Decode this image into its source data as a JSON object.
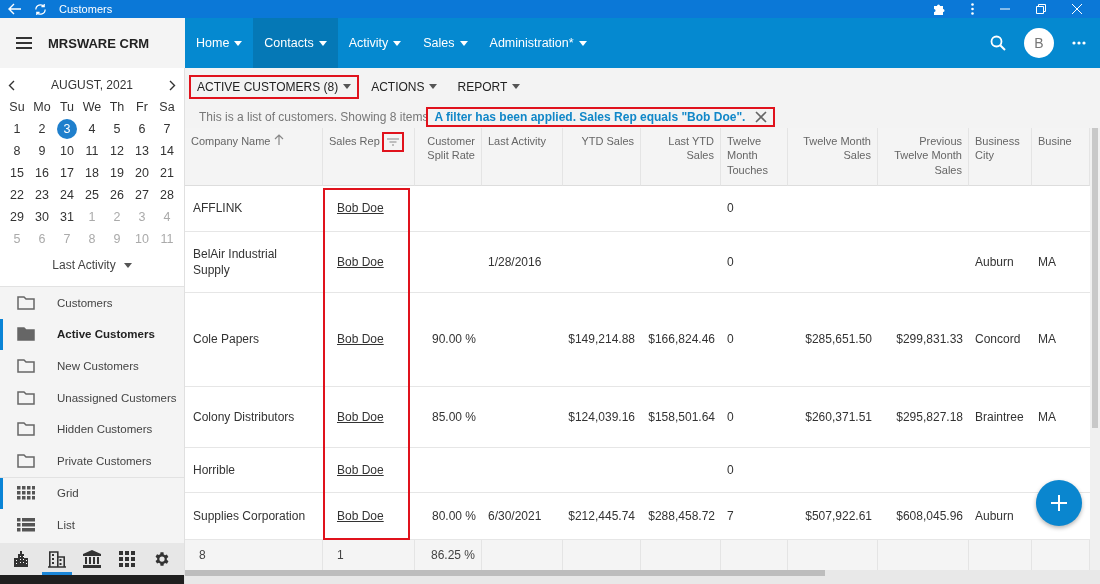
{
  "window": {
    "title": "Customers"
  },
  "app": {
    "name": "MRSWARE CRM",
    "avatar": "B"
  },
  "nav": [
    {
      "label": "Home",
      "selected": false
    },
    {
      "label": "Contacts",
      "selected": true
    },
    {
      "label": "Activity",
      "selected": false
    },
    {
      "label": "Sales",
      "selected": false
    },
    {
      "label": "Administration*",
      "selected": false
    }
  ],
  "calendar": {
    "month": "AUGUST, 2021",
    "weekdays": [
      "Su",
      "Mo",
      "Tu",
      "We",
      "Th",
      "Fr",
      "Sa"
    ],
    "weeks": [
      [
        {
          "day": "1",
          "current_month": true,
          "selected": false
        },
        {
          "day": "2",
          "current_month": true,
          "selected": false
        },
        {
          "day": "3",
          "current_month": true,
          "selected": true
        },
        {
          "day": "4",
          "current_month": true,
          "selected": false
        },
        {
          "day": "5",
          "current_month": true,
          "selected": false
        },
        {
          "day": "6",
          "current_month": true,
          "selected": false
        },
        {
          "day": "7",
          "current_month": true,
          "selected": false
        }
      ],
      [
        {
          "day": "8",
          "current_month": true,
          "selected": false
        },
        {
          "day": "9",
          "current_month": true,
          "selected": false
        },
        {
          "day": "10",
          "current_month": true,
          "selected": false
        },
        {
          "day": "11",
          "current_month": true,
          "selected": false
        },
        {
          "day": "12",
          "current_month": true,
          "selected": false
        },
        {
          "day": "13",
          "current_month": true,
          "selected": false
        },
        {
          "day": "14",
          "current_month": true,
          "selected": false
        }
      ],
      [
        {
          "day": "15",
          "current_month": true,
          "selected": false
        },
        {
          "day": "16",
          "current_month": true,
          "selected": false
        },
        {
          "day": "17",
          "current_month": true,
          "selected": false
        },
        {
          "day": "18",
          "current_month": true,
          "selected": false
        },
        {
          "day": "19",
          "current_month": true,
          "selected": false
        },
        {
          "day": "20",
          "current_month": true,
          "selected": false
        },
        {
          "day": "21",
          "current_month": true,
          "selected": false
        }
      ],
      [
        {
          "day": "22",
          "current_month": true,
          "selected": false
        },
        {
          "day": "23",
          "current_month": true,
          "selected": false
        },
        {
          "day": "24",
          "current_month": true,
          "selected": false
        },
        {
          "day": "25",
          "current_month": true,
          "selected": false
        },
        {
          "day": "26",
          "current_month": true,
          "selected": false
        },
        {
          "day": "27",
          "current_month": true,
          "selected": false
        },
        {
          "day": "28",
          "current_month": true,
          "selected": false
        }
      ],
      [
        {
          "day": "29",
          "current_month": true,
          "selected": false
        },
        {
          "day": "30",
          "current_month": true,
          "selected": false
        },
        {
          "day": "31",
          "current_month": true,
          "selected": false
        },
        {
          "day": "1",
          "current_month": false,
          "selected": false
        },
        {
          "day": "2",
          "current_month": false,
          "selected": false
        },
        {
          "day": "3",
          "current_month": false,
          "selected": false
        },
        {
          "day": "4",
          "current_month": false,
          "selected": false
        }
      ],
      [
        {
          "day": "5",
          "current_month": false,
          "selected": false
        },
        {
          "day": "6",
          "current_month": false,
          "selected": false
        },
        {
          "day": "7",
          "current_month": false,
          "selected": false
        },
        {
          "day": "8",
          "current_month": false,
          "selected": false
        },
        {
          "day": "9",
          "current_month": false,
          "selected": false
        },
        {
          "day": "10",
          "current_month": false,
          "selected": false
        },
        {
          "day": "11",
          "current_month": false,
          "selected": false
        }
      ]
    ],
    "date_field": "Last Activity"
  },
  "folders": [
    {
      "label": "Customers",
      "selected": false
    },
    {
      "label": "Active Customers",
      "selected": true
    },
    {
      "label": "New Customers",
      "selected": false
    },
    {
      "label": "Unassigned Customers",
      "selected": false
    },
    {
      "label": "Hidden Customers",
      "selected": false
    },
    {
      "label": "Private Customers",
      "selected": false
    }
  ],
  "views": [
    {
      "label": "Grid",
      "kind": "grid",
      "selected": true
    },
    {
      "label": "List",
      "kind": "list",
      "selected": false
    }
  ],
  "bottom_tabs": [
    {
      "kind": "city",
      "selected": false
    },
    {
      "kind": "building",
      "selected": true
    },
    {
      "kind": "bank",
      "selected": false
    },
    {
      "kind": "apps",
      "selected": false
    },
    {
      "kind": "settings",
      "selected": false
    }
  ],
  "toolbar": [
    {
      "label": "ACTIVE CUSTOMERS (8)",
      "annotated": true
    },
    {
      "label": "ACTIONS",
      "annotated": false
    },
    {
      "label": "REPORT",
      "annotated": false
    }
  ],
  "info": {
    "text": "This is a list of customers. Showing 8 items",
    "filter_notice": "A filter has been applied. Sales Rep equals \"Bob Doe\".",
    "annotated": true
  },
  "table": {
    "columns": [
      {
        "label": "Company Name",
        "kind": "text",
        "sorted": true,
        "filtered": false,
        "annotated": false
      },
      {
        "label": "Sales Rep",
        "kind": "link",
        "sorted": false,
        "filtered": true,
        "annotated": true
      },
      {
        "label": "Customer Split Rate",
        "kind": "text",
        "sorted": false,
        "filtered": false,
        "annotated": false
      },
      {
        "label": "Last Activity",
        "kind": "text",
        "sorted": false,
        "filtered": false,
        "annotated": false
      },
      {
        "label": "YTD Sales",
        "kind": "text",
        "sorted": false,
        "filtered": false,
        "annotated": false
      },
      {
        "label": "Last YTD Sales",
        "kind": "text",
        "sorted": false,
        "filtered": false,
        "annotated": false
      },
      {
        "label": "Twelve Month Touches",
        "kind": "text",
        "sorted": false,
        "filtered": false,
        "annotated": false
      },
      {
        "label": "Twelve Month Sales",
        "kind": "text",
        "sorted": false,
        "filtered": false,
        "annotated": false
      },
      {
        "label": "Previous Twelve Month Sales",
        "kind": "text",
        "sorted": false,
        "filtered": false,
        "annotated": false
      },
      {
        "label": "Business City",
        "kind": "text",
        "sorted": false,
        "filtered": false,
        "annotated": false
      },
      {
        "label": "Busine",
        "kind": "text",
        "sorted": false,
        "filtered": false,
        "annotated": false
      }
    ],
    "rows": [
      [
        "AFFLINK",
        "Bob Doe",
        null,
        null,
        null,
        null,
        "0",
        null,
        null,
        null,
        null
      ],
      [
        "BelAir Industrial Supply",
        "Bob Doe",
        null,
        "1/28/2016",
        null,
        null,
        "0",
        null,
        null,
        "Auburn",
        "MA"
      ],
      [
        "Cole Papers",
        "Bob Doe",
        "90.00 %",
        null,
        "$149,214.88",
        "$166,824.46",
        "0",
        "$285,651.50",
        "$299,831.33",
        "Concord",
        "MA"
      ],
      [
        "Colony Distributors",
        "Bob Doe",
        "85.00 %",
        null,
        "$124,039.16",
        "$158,501.64",
        "0",
        "$260,371.51",
        "$295,827.18",
        "Braintree",
        "MA"
      ],
      [
        "Horrible",
        "Bob Doe",
        null,
        null,
        null,
        null,
        "0",
        null,
        null,
        null,
        null
      ],
      [
        "Supplies Corporation",
        "Bob Doe",
        "80.00 %",
        "6/30/2021",
        "$212,445.74",
        "$288,458.72",
        "7",
        "$507,922.61",
        "$608,045.96",
        "Auburn",
        null
      ]
    ],
    "footer": [
      "8",
      "1",
      "86.25 %"
    ]
  }
}
